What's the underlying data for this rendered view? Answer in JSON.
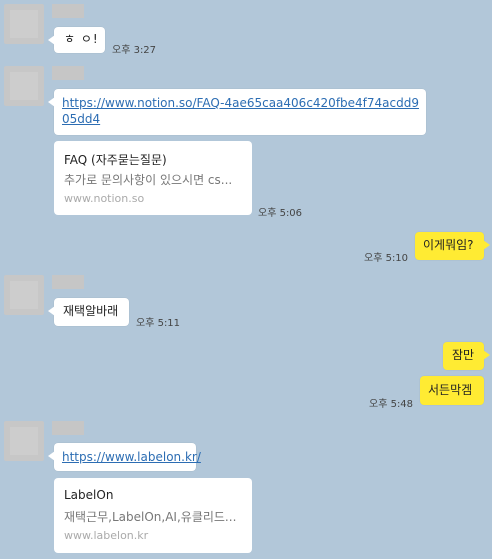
{
  "messages": {
    "m1": {
      "text": "ㅎ ㅇ!",
      "time": "오후 3:27"
    },
    "m2": {
      "link": "https://www.notion.so/FAQ-4ae65caa406c420fbe4f74acdd905dd4",
      "card_title": "FAQ (자주묻는질문)",
      "card_desc": "추가로 문의사항이 있으시면 cs...",
      "card_host": "www.notion.so",
      "time": "오후 5:06"
    },
    "m3": {
      "text": "이게뭐임?",
      "time": "오후 5:10"
    },
    "m4": {
      "text": "재택알바래",
      "time": "오후 5:11"
    },
    "m5": {
      "text": "잠만"
    },
    "m6": {
      "text": "서든막겜",
      "time": "오후 5:48"
    },
    "m7": {
      "link": "https://www.labelon.kr/",
      "card_title": "LabelOn",
      "card_desc": "재택근무,LabelOn,AI,유클리드...",
      "card_host": "www.labelon.kr"
    }
  },
  "colors": {
    "background": "#b2c7d9",
    "my_bubble": "#ffeb33",
    "other_bubble": "#ffffff",
    "link": "#2c6db3"
  }
}
